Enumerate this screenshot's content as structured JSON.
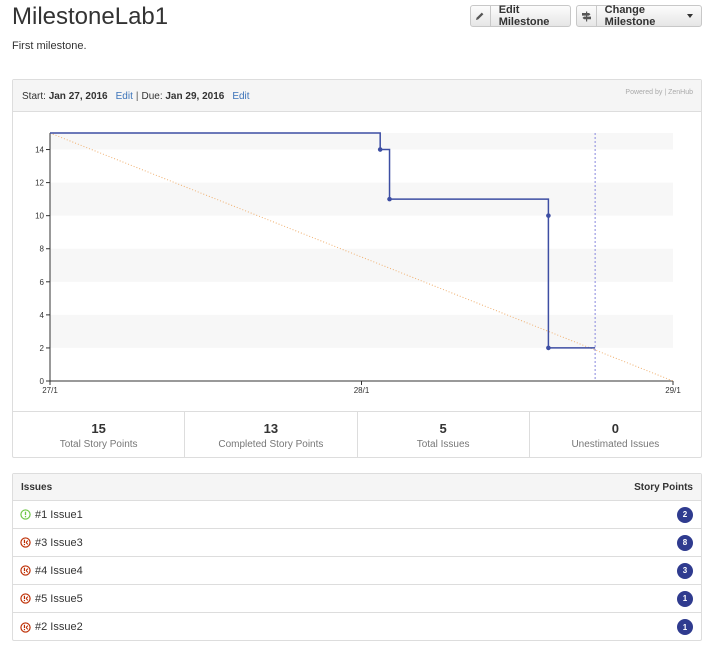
{
  "header": {
    "title": "MilestoneLab1",
    "subtitle": "First milestone.",
    "edit_button": "Edit Milestone",
    "change_button": "Change Milestone"
  },
  "panel": {
    "start_label": "Start:",
    "start_date": "Jan 27, 2016",
    "start_edit": "Edit",
    "separator": "|",
    "due_label": "Due:",
    "due_date": "Jan 29, 2016",
    "due_edit": "Edit",
    "powered_by": "Powered by | ZenHub"
  },
  "chart_data": {
    "type": "line",
    "x_ticks": [
      "27/1",
      "28/1",
      "29/1"
    ],
    "y_ticks": [
      0,
      2,
      4,
      6,
      8,
      10,
      12,
      14
    ],
    "ylim": [
      0,
      15
    ],
    "xlim": [
      0,
      2
    ],
    "grid": "alternating bands",
    "series": [
      {
        "style": "step",
        "color": "#3d4ea3",
        "points": [
          [
            0,
            15
          ],
          [
            1.06,
            15
          ],
          [
            1.06,
            14
          ],
          [
            1.09,
            14
          ],
          [
            1.09,
            11
          ],
          [
            1.6,
            11
          ],
          [
            1.6,
            10
          ],
          [
            1.6,
            2
          ],
          [
            1.75,
            2
          ]
        ],
        "markers": [
          [
            1.06,
            14
          ],
          [
            1.09,
            11
          ],
          [
            1.6,
            10
          ],
          [
            1.6,
            2
          ]
        ]
      },
      {
        "style": "dotted",
        "color": "#f0b070",
        "points": [
          [
            0,
            15
          ],
          [
            2,
            0
          ]
        ]
      }
    ],
    "today_x": 1.75,
    "today_color": "#8888dd"
  },
  "stats": [
    {
      "value": "15",
      "label": "Total Story Points"
    },
    {
      "value": "13",
      "label": "Completed Story Points"
    },
    {
      "value": "5",
      "label": "Total Issues"
    },
    {
      "value": "0",
      "label": "Unestimated Issues"
    }
  ],
  "issues": {
    "header_left": "Issues",
    "header_right": "Story Points",
    "rows": [
      {
        "label": "#1 Issue1",
        "points": "2",
        "status": "open"
      },
      {
        "label": "#3 Issue3",
        "points": "8",
        "status": "closed"
      },
      {
        "label": "#4 Issue4",
        "points": "3",
        "status": "closed"
      },
      {
        "label": "#5 Issue5",
        "points": "1",
        "status": "closed"
      },
      {
        "label": "#2 Issue2",
        "points": "1",
        "status": "closed"
      }
    ]
  },
  "colors": {
    "open": "#6cc644",
    "closed": "#bd2c00",
    "badge": "#2f3b8f",
    "link": "#3b73b9"
  }
}
